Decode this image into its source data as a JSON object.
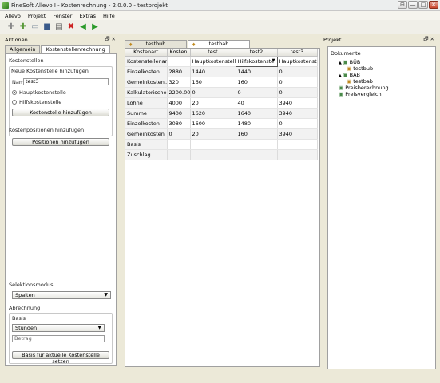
{
  "window": {
    "title": "FineSoft Allevo I - Kostenrechnung - 2.0.0.0 - testprojekt",
    "controls": [
      "⊟",
      "—",
      "□",
      "✕"
    ]
  },
  "menu": [
    "Allevo",
    "Projekt",
    "Fenster",
    "Extras",
    "Hilfe"
  ],
  "toolbar": [
    {
      "name": "add-icon",
      "glyph": "✚",
      "color": "#888888"
    },
    {
      "name": "add-green-icon",
      "glyph": "✚",
      "color": "#5a9a3a"
    },
    {
      "name": "window-icon",
      "glyph": "▭",
      "color": "#7a8a9a"
    },
    {
      "name": "save-icon",
      "glyph": "■",
      "color": "#3a5a8a"
    },
    {
      "name": "print-icon",
      "glyph": "▤",
      "color": "#555555"
    },
    {
      "name": "delete-icon",
      "glyph": "✖",
      "color": "#cc2222"
    },
    {
      "name": "back-icon",
      "glyph": "◀",
      "color": "#2a9a2a"
    },
    {
      "name": "forward-icon",
      "glyph": "▶",
      "color": "#2a9a2a"
    }
  ],
  "left": {
    "panel_title": "Aktionen",
    "panel_controls": "🗗 ✕",
    "tabs": [
      "Allgemein",
      "Kostenstellenrechnung"
    ],
    "kostenstellen_label": "Kostenstellen",
    "neue_label": "Neue Kostenstelle hinzufügen",
    "name_label": "Name",
    "name_value": "test3",
    "radio_main": "Hauptkostenstelle",
    "radio_aux": "Hilfskostenstelle",
    "add_kst_button": "Kostenstelle hinzufügen",
    "positions_label": "Kostenpositionen hinzufügen",
    "positions_button": "Positionen hinzufügen",
    "selection_label": "Selektionsmodus",
    "selection_value": "Spalten",
    "abrechnung_label": "Abrechnung",
    "basis_label": "Basis",
    "basis_value": "Stunden",
    "betrag_placeholder": "Betrag",
    "basis_button": "Basis für aktuelle Kostenstelle setzen"
  },
  "center": {
    "doc_tabs": [
      "testbub",
      "testbab"
    ],
    "columns": [
      "Kostenart",
      "Kosten",
      "test",
      "test2",
      "test3"
    ],
    "rows": [
      {
        "label": "Kostenstellenart",
        "cells": [
          "",
          "Hauptkostenstelle",
          "Hilfskostenste",
          "Hauptkostenstelle"
        ]
      },
      {
        "label": "Einzelkosten...",
        "cells": [
          "2880",
          "1440",
          "1440",
          "0"
        ]
      },
      {
        "label": "Gemeinkosten...",
        "cells": [
          "320",
          "160",
          "160",
          "0"
        ]
      },
      {
        "label": "Kalkulatorische...",
        "cells": [
          "2200.00",
          "0",
          "0",
          "0"
        ]
      },
      {
        "label": "Löhne",
        "cells": [
          "4000",
          "20",
          "40",
          "3940"
        ]
      },
      {
        "label": "Summe",
        "cells": [
          "9400",
          "1620",
          "1640",
          "3940"
        ]
      },
      {
        "label": "Einzelkosten",
        "cells": [
          "3080",
          "1600",
          "1480",
          "0"
        ]
      },
      {
        "label": "Gemeinkosten",
        "cells": [
          "0",
          "20",
          "160",
          "3940"
        ]
      },
      {
        "label": "Basis",
        "cells": [
          "",
          "",
          "",
          ""
        ]
      },
      {
        "label": "Zuschlag",
        "cells": [
          "",
          "",
          "",
          ""
        ]
      }
    ]
  },
  "right": {
    "panel_title": "Projekt",
    "panel_controls": "🗗 ✕",
    "tree": [
      {
        "label": "Dokumente",
        "level": 0
      },
      {
        "label": "BÜB",
        "level": 1,
        "expander": "▲"
      },
      {
        "label": "testbub",
        "level": 2
      },
      {
        "label": "BAB",
        "level": 1,
        "expander": "▲"
      },
      {
        "label": "testbab",
        "level": 2
      },
      {
        "label": "Preisberechnung",
        "level": 1
      },
      {
        "label": "Preisvergleich",
        "level": 1
      }
    ]
  }
}
